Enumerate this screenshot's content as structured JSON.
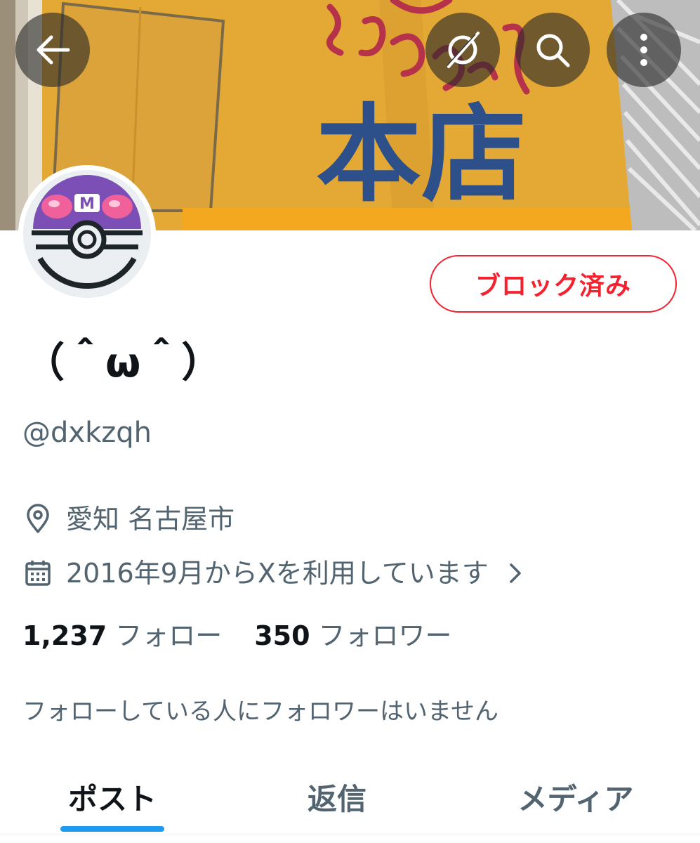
{
  "banner": {
    "sign_text": "本店",
    "sign_script": "やまちゃん"
  },
  "header": {
    "back_icon": "arrow-left-icon",
    "grok_icon": "grok-icon",
    "search_icon": "search-icon",
    "more_icon": "more-vertical-icon"
  },
  "avatar": {
    "description": "master-ball",
    "letter": "M"
  },
  "profile": {
    "block_button_label": "ブロック済み",
    "display_name": "（＾ω＾）",
    "handle": "@dxkzqh",
    "location": "愛知 名古屋市",
    "joined": "2016年9月からXを利用しています",
    "following_count": "1,237",
    "following_label": "フォロー",
    "followers_count": "350",
    "followers_label": "フォロワー",
    "followers_you_know": "フォローしている人にフォロワーはいません"
  },
  "tabs": [
    {
      "label": "ポスト",
      "active": true
    },
    {
      "label": "返信",
      "active": false
    },
    {
      "label": "メディア",
      "active": false
    }
  ],
  "colors": {
    "accent": "#1d9bf0",
    "block_red": "#f4212e",
    "secondary_text": "#536471",
    "primary_text": "#0f1419"
  }
}
